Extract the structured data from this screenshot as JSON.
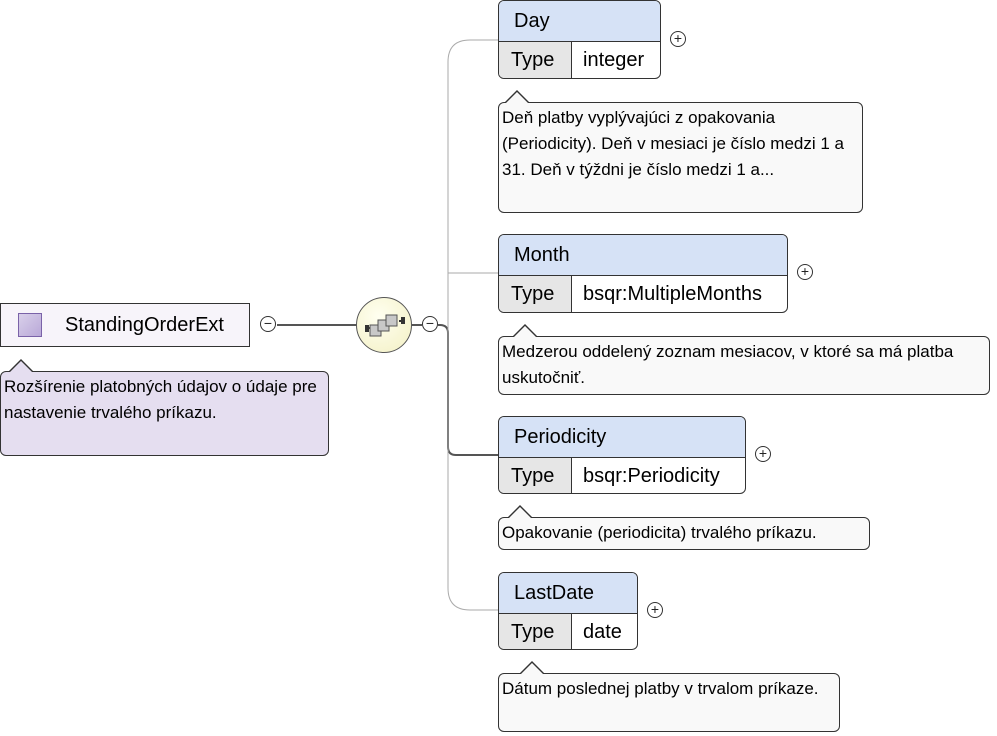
{
  "root": {
    "name": "StandingOrderExt",
    "description": "Rozšírenie platobných údajov o údaje pre nastavenie trvalého príkazu."
  },
  "compositor": {
    "icon": "sequence-icon"
  },
  "toggles": {
    "expanded": "−",
    "collapsed": "+"
  },
  "type_label": "Type",
  "elements": [
    {
      "name": "Day",
      "type": "integer",
      "description": "Deň platby vyplývajúci z opakovania (Periodicity). Deň v mesiaci je číslo medzi 1 a 31. Deň v týždni je číslo medzi 1 a..."
    },
    {
      "name": "Month",
      "type": "bsqr:MultipleMonths",
      "description": "Medzerou oddelený zoznam mesiacov, v ktoré sa má platba uskutočniť."
    },
    {
      "name": "Periodicity",
      "type": "bsqr:Periodicity",
      "description": "Opakovanie (periodicita) trvalého príkazu."
    },
    {
      "name": "LastDate",
      "type": "date",
      "description": "Dátum poslednej platby v trvalom príkaze."
    }
  ],
  "colors": {
    "element_header": "#d6e2f6",
    "type_cell": "#e6e6e6",
    "root_annotation": "#e5def0",
    "element_annotation": "#f9f9f9",
    "sequence_fill": "#f3f0c4"
  }
}
